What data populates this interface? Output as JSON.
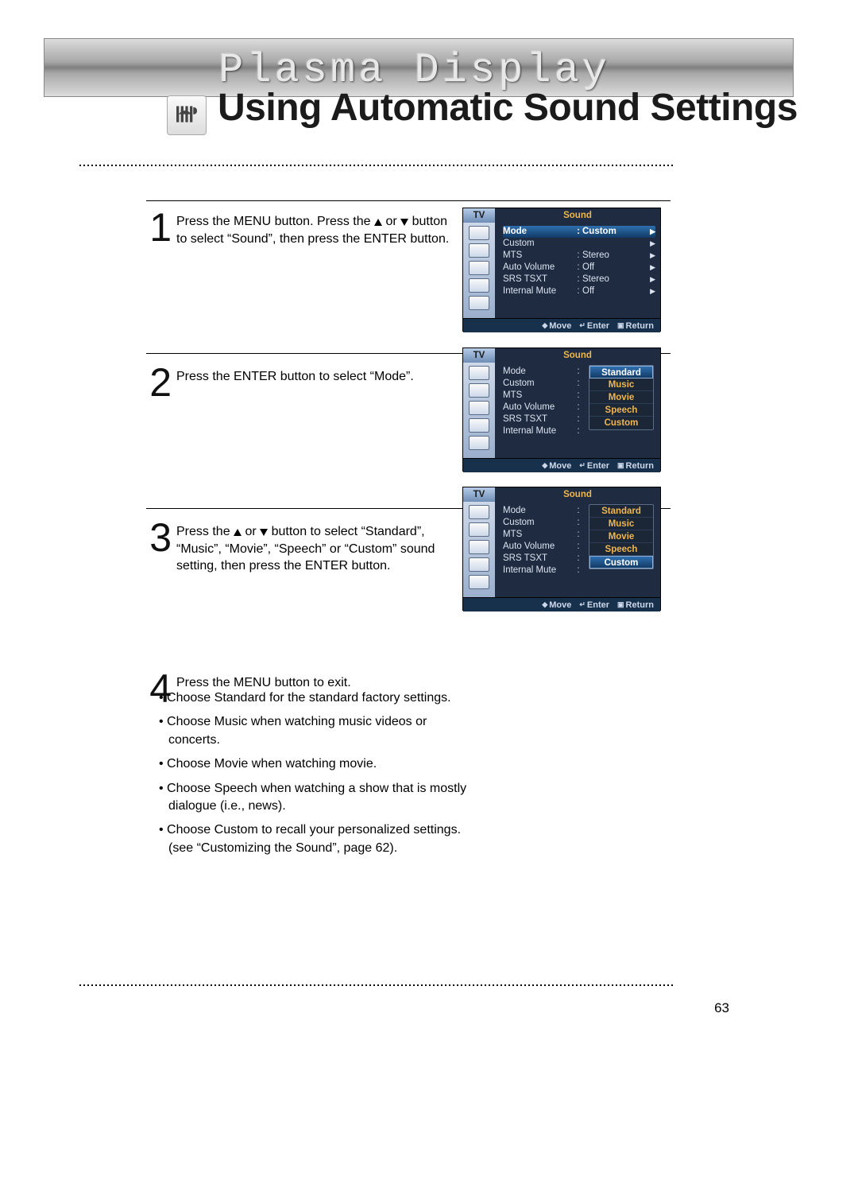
{
  "banner_title": "Plasma Display",
  "page_title": "Using Automatic Sound Settings",
  "page_number": "63",
  "steps": [
    {
      "num": "1",
      "text_before": "Press the MENU button. Press the ",
      "text_mid": " or ",
      "text_after": " button to select “Sound”, then press the ENTER button."
    },
    {
      "num": "2",
      "text": "Press the ENTER button to select “Mode”."
    },
    {
      "num": "3",
      "text_before": "Press the ",
      "text_mid": " or ",
      "text_after": " button to select “Standard”, “Music”, “Movie”, “Speech” or “Custom” sound setting, then press the ENTER button."
    },
    {
      "num": "4",
      "text": "Press the MENU button to exit."
    }
  ],
  "notes": [
    "Choose Standard for the standard factory settings.",
    "Choose Music when watching music videos or concerts.",
    "Choose Movie when watching movie.",
    "Choose Speech when watching a show that is mostly dialogue (i.e., news).",
    "Choose Custom to recall your personalized settings. (see “Customizing the Sound”, page 62)."
  ],
  "osd": {
    "tv": "TV",
    "title": "Sound",
    "navbar": {
      "move": "Move",
      "enter": "Enter",
      "return": "Return"
    },
    "screen1": {
      "rows": [
        {
          "label": "Mode",
          "val": "Custom",
          "sel": true,
          "arrow": true
        },
        {
          "label": "Custom",
          "val": "",
          "arrow": true
        },
        {
          "label": "MTS",
          "val": "Stereo",
          "arrow": true
        },
        {
          "label": "Auto Volume",
          "val": "Off",
          "arrow": true
        },
        {
          "label": "SRS TSXT",
          "val": "Stereo",
          "arrow": true
        },
        {
          "label": "Internal Mute",
          "val": "Off",
          "arrow": true
        }
      ]
    },
    "screen2": {
      "rows_labels": [
        "Mode",
        "Custom",
        "MTS",
        "Auto Volume",
        "SRS TSXT",
        "Internal Mute"
      ],
      "dropdown": [
        "Standard",
        "Music",
        "Movie",
        "Speech",
        "Custom"
      ],
      "dropdown_sel_index": 0
    },
    "screen3": {
      "rows_labels": [
        "Mode",
        "Custom",
        "MTS",
        "Auto Volume",
        "SRS TSXT",
        "Internal Mute"
      ],
      "dropdown": [
        "Standard",
        "Music",
        "Movie",
        "Speech",
        "Custom"
      ],
      "dropdown_sel_index": 4
    }
  }
}
